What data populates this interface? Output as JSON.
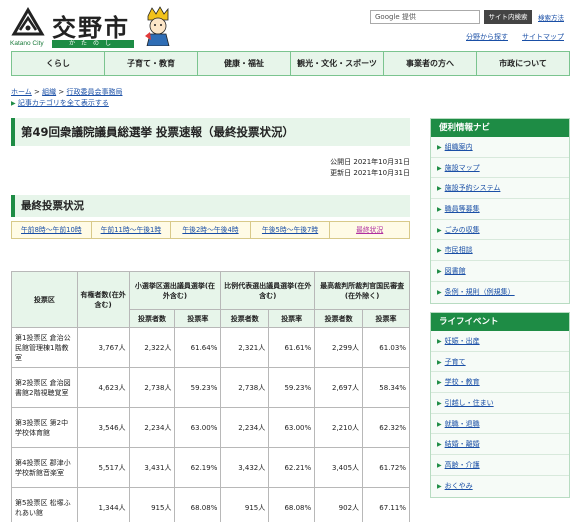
{
  "header": {
    "city_name": "交野市",
    "city_en": "Katano City",
    "city_kana": "かたのし",
    "search_placeholder": "Google 提供",
    "search_button": "サイト内検索",
    "search_help": "検索方法",
    "link_field": "分野から探す",
    "link_sitemap": "サイトマップ"
  },
  "gnav": [
    "くらし",
    "子育て・教育",
    "健康・福祉",
    "観光・文化・スポーツ",
    "事業者の方へ",
    "市政について"
  ],
  "breadcrumb": {
    "items": [
      "ホーム",
      "組織",
      "行政委員会事務局"
    ],
    "sep": " > ",
    "show_all": "記事カテゴリを全て表示する"
  },
  "page": {
    "title": "第49回衆議院議員総選挙 投票速報（最終投票状況）",
    "published": "公開日 2021年10月31日",
    "updated": "更新日 2021年10月31日",
    "section_title": "最終投票状況"
  },
  "tabs": [
    "午前8時〜午前10時",
    "午前11時〜午後1時",
    "午後2時〜午後4時",
    "午後5時〜午後7時",
    "最終状況"
  ],
  "table": {
    "h_district": "投票区",
    "h_voters": "有権者数(在外含む)",
    "h_single": "小選挙区選出議員選挙(在外含む)",
    "h_pr": "比例代表選出議員選挙(在外含む)",
    "h_court": "最高裁判所裁判官国民審査(在外除く)",
    "h_count": "投票者数",
    "h_rate": "投票率",
    "rows": [
      {
        "district": "第1投票区 倉治公民館管理棟1階教室",
        "voters": "3,767人",
        "s_count": "2,322人",
        "s_rate": "61.64%",
        "p_count": "2,321人",
        "p_rate": "61.61%",
        "c_count": "2,299人",
        "c_rate": "61.03%"
      },
      {
        "district": "第2投票区 倉治図書館2階視聴覚室",
        "voters": "4,623人",
        "s_count": "2,738人",
        "s_rate": "59.23%",
        "p_count": "2,738人",
        "p_rate": "59.23%",
        "c_count": "2,697人",
        "c_rate": "58.34%"
      },
      {
        "district": "第3投票区 第2中学校体育館",
        "voters": "3,546人",
        "s_count": "2,234人",
        "s_rate": "63.00%",
        "p_count": "2,234人",
        "p_rate": "63.00%",
        "c_count": "2,210人",
        "c_rate": "62.32%"
      },
      {
        "district": "第4投票区 郡津小学校新館音楽室",
        "voters": "5,517人",
        "s_count": "3,431人",
        "s_rate": "62.19%",
        "p_count": "3,432人",
        "p_rate": "62.21%",
        "c_count": "3,405人",
        "c_rate": "61.72%"
      },
      {
        "district": "第5投票区 松塚ふれあい館",
        "voters": "1,344人",
        "s_count": "915人",
        "s_rate": "68.08%",
        "p_count": "915人",
        "p_rate": "68.08%",
        "c_count": "902人",
        "c_rate": "67.11%"
      }
    ]
  },
  "side_nav": {
    "title": "便利情報ナビ",
    "items": [
      "組織案内",
      "施設マップ",
      "施設予約システム",
      "職員等募集",
      "ごみの収集",
      "市民相談",
      "図書館",
      "条例・規則（例規集）"
    ]
  },
  "side_life": {
    "title": "ライフイベント",
    "items": [
      "妊娠・出産",
      "子育て",
      "学校・教育",
      "引越し・住まい",
      "就職・退職",
      "結婚・離婚",
      "高齢・介護",
      "おくやみ"
    ]
  },
  "colors": {
    "accent": "#1e8c45",
    "nav_bg": "#e7f5ea",
    "link": "#1a4fa6",
    "active_tab": "#b0309f"
  }
}
